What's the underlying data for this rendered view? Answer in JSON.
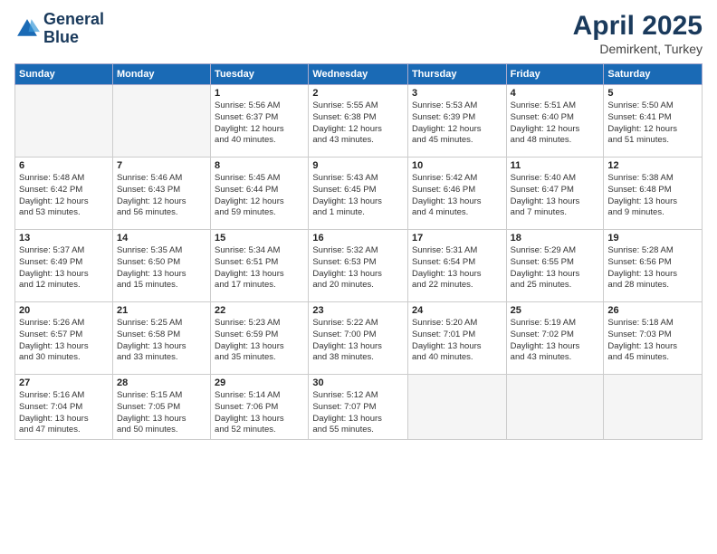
{
  "logo": {
    "line1": "General",
    "line2": "Blue"
  },
  "title": "April 2025",
  "subtitle": "Demirkent, Turkey",
  "weekdays": [
    "Sunday",
    "Monday",
    "Tuesday",
    "Wednesday",
    "Thursday",
    "Friday",
    "Saturday"
  ],
  "weeks": [
    [
      {
        "day": "",
        "detail": ""
      },
      {
        "day": "",
        "detail": ""
      },
      {
        "day": "1",
        "detail": "Sunrise: 5:56 AM\nSunset: 6:37 PM\nDaylight: 12 hours\nand 40 minutes."
      },
      {
        "day": "2",
        "detail": "Sunrise: 5:55 AM\nSunset: 6:38 PM\nDaylight: 12 hours\nand 43 minutes."
      },
      {
        "day": "3",
        "detail": "Sunrise: 5:53 AM\nSunset: 6:39 PM\nDaylight: 12 hours\nand 45 minutes."
      },
      {
        "day": "4",
        "detail": "Sunrise: 5:51 AM\nSunset: 6:40 PM\nDaylight: 12 hours\nand 48 minutes."
      },
      {
        "day": "5",
        "detail": "Sunrise: 5:50 AM\nSunset: 6:41 PM\nDaylight: 12 hours\nand 51 minutes."
      }
    ],
    [
      {
        "day": "6",
        "detail": "Sunrise: 5:48 AM\nSunset: 6:42 PM\nDaylight: 12 hours\nand 53 minutes."
      },
      {
        "day": "7",
        "detail": "Sunrise: 5:46 AM\nSunset: 6:43 PM\nDaylight: 12 hours\nand 56 minutes."
      },
      {
        "day": "8",
        "detail": "Sunrise: 5:45 AM\nSunset: 6:44 PM\nDaylight: 12 hours\nand 59 minutes."
      },
      {
        "day": "9",
        "detail": "Sunrise: 5:43 AM\nSunset: 6:45 PM\nDaylight: 13 hours\nand 1 minute."
      },
      {
        "day": "10",
        "detail": "Sunrise: 5:42 AM\nSunset: 6:46 PM\nDaylight: 13 hours\nand 4 minutes."
      },
      {
        "day": "11",
        "detail": "Sunrise: 5:40 AM\nSunset: 6:47 PM\nDaylight: 13 hours\nand 7 minutes."
      },
      {
        "day": "12",
        "detail": "Sunrise: 5:38 AM\nSunset: 6:48 PM\nDaylight: 13 hours\nand 9 minutes."
      }
    ],
    [
      {
        "day": "13",
        "detail": "Sunrise: 5:37 AM\nSunset: 6:49 PM\nDaylight: 13 hours\nand 12 minutes."
      },
      {
        "day": "14",
        "detail": "Sunrise: 5:35 AM\nSunset: 6:50 PM\nDaylight: 13 hours\nand 15 minutes."
      },
      {
        "day": "15",
        "detail": "Sunrise: 5:34 AM\nSunset: 6:51 PM\nDaylight: 13 hours\nand 17 minutes."
      },
      {
        "day": "16",
        "detail": "Sunrise: 5:32 AM\nSunset: 6:53 PM\nDaylight: 13 hours\nand 20 minutes."
      },
      {
        "day": "17",
        "detail": "Sunrise: 5:31 AM\nSunset: 6:54 PM\nDaylight: 13 hours\nand 22 minutes."
      },
      {
        "day": "18",
        "detail": "Sunrise: 5:29 AM\nSunset: 6:55 PM\nDaylight: 13 hours\nand 25 minutes."
      },
      {
        "day": "19",
        "detail": "Sunrise: 5:28 AM\nSunset: 6:56 PM\nDaylight: 13 hours\nand 28 minutes."
      }
    ],
    [
      {
        "day": "20",
        "detail": "Sunrise: 5:26 AM\nSunset: 6:57 PM\nDaylight: 13 hours\nand 30 minutes."
      },
      {
        "day": "21",
        "detail": "Sunrise: 5:25 AM\nSunset: 6:58 PM\nDaylight: 13 hours\nand 33 minutes."
      },
      {
        "day": "22",
        "detail": "Sunrise: 5:23 AM\nSunset: 6:59 PM\nDaylight: 13 hours\nand 35 minutes."
      },
      {
        "day": "23",
        "detail": "Sunrise: 5:22 AM\nSunset: 7:00 PM\nDaylight: 13 hours\nand 38 minutes."
      },
      {
        "day": "24",
        "detail": "Sunrise: 5:20 AM\nSunset: 7:01 PM\nDaylight: 13 hours\nand 40 minutes."
      },
      {
        "day": "25",
        "detail": "Sunrise: 5:19 AM\nSunset: 7:02 PM\nDaylight: 13 hours\nand 43 minutes."
      },
      {
        "day": "26",
        "detail": "Sunrise: 5:18 AM\nSunset: 7:03 PM\nDaylight: 13 hours\nand 45 minutes."
      }
    ],
    [
      {
        "day": "27",
        "detail": "Sunrise: 5:16 AM\nSunset: 7:04 PM\nDaylight: 13 hours\nand 47 minutes."
      },
      {
        "day": "28",
        "detail": "Sunrise: 5:15 AM\nSunset: 7:05 PM\nDaylight: 13 hours\nand 50 minutes."
      },
      {
        "day": "29",
        "detail": "Sunrise: 5:14 AM\nSunset: 7:06 PM\nDaylight: 13 hours\nand 52 minutes."
      },
      {
        "day": "30",
        "detail": "Sunrise: 5:12 AM\nSunset: 7:07 PM\nDaylight: 13 hours\nand 55 minutes."
      },
      {
        "day": "",
        "detail": ""
      },
      {
        "day": "",
        "detail": ""
      },
      {
        "day": "",
        "detail": ""
      }
    ]
  ]
}
